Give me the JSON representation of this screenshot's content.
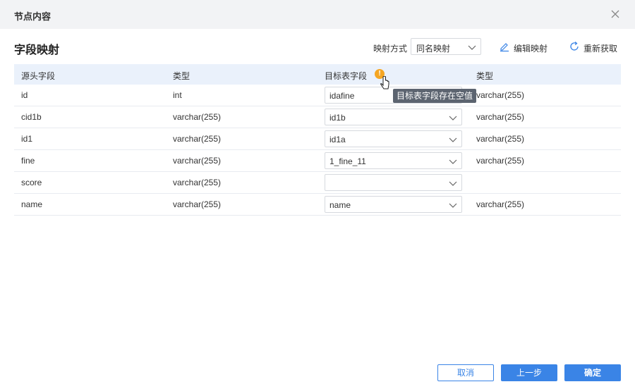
{
  "dialog": {
    "title": "节点内容"
  },
  "section": {
    "title": "字段映射"
  },
  "map_mode": {
    "label": "映射方式",
    "value": "同名映射"
  },
  "toolbar": {
    "edit_label": "编辑映射",
    "refresh_label": "重新获取"
  },
  "table": {
    "headers": [
      "源头字段",
      "类型",
      "目标表字段",
      "类型"
    ],
    "rows": [
      {
        "source": "id",
        "type": "int",
        "target": "idafine",
        "target_type": "varchar(255)"
      },
      {
        "source": "cid1b",
        "type": "varchar(255)",
        "target": "id1b",
        "target_type": "varchar(255)"
      },
      {
        "source": "id1",
        "type": "varchar(255)",
        "target": "id1a",
        "target_type": "varchar(255)"
      },
      {
        "source": "fine",
        "type": "varchar(255)",
        "target": "1_fine_11",
        "target_type": "varchar(255)"
      },
      {
        "source": "score",
        "type": "varchar(255)",
        "target": "",
        "target_type": ""
      },
      {
        "source": "name",
        "type": "varchar(255)",
        "target": "name",
        "target_type": "varchar(255)"
      }
    ]
  },
  "tooltip": {
    "text": "目标表字段存在空值"
  },
  "footer": {
    "cancel": "取消",
    "prev": "上一步",
    "ok": "确定"
  },
  "colors": {
    "accent": "#3a84e6",
    "warning": "#f5a623",
    "header_bg": "#eaf1fb"
  }
}
